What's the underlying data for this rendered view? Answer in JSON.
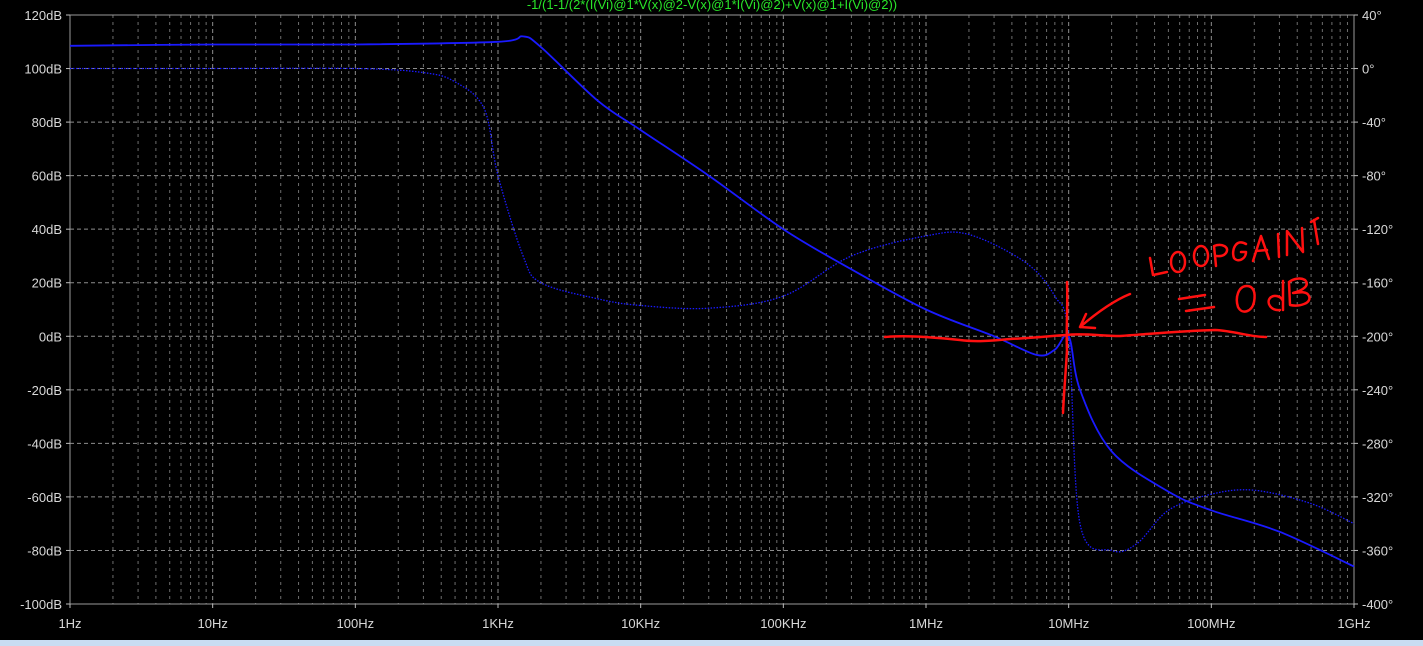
{
  "window": {
    "trace_expression": "-1/(1-1/(2*(I(Vi)@1*V(x)@2-V(x)@1*I(Vi)@2)+V(x)@1+I(Vi)@2))"
  },
  "chart_data": {
    "type": "line",
    "xscale": "log",
    "xlim": [
      1,
      1000000000
    ],
    "x_ticks": [
      1,
      10,
      100,
      1000,
      10000,
      100000,
      1000000,
      10000000,
      100000000,
      1000000000
    ],
    "x_tick_labels": [
      "1Hz",
      "10Hz",
      "100Hz",
      "1KHz",
      "10KHz",
      "100KHz",
      "1MHz",
      "10MHz",
      "100MHz",
      "1GHz"
    ],
    "ylim_left": [
      -100,
      120
    ],
    "y_ticks_left": [
      120,
      100,
      80,
      60,
      40,
      20,
      0,
      -20,
      -40,
      -60,
      -80,
      -100
    ],
    "y_tick_labels_left": [
      "120dB",
      "100dB",
      "80dB",
      "60dB",
      "40dB",
      "20dB",
      "0dB",
      "-20dB",
      "-40dB",
      "-60dB",
      "-80dB",
      "-100dB"
    ],
    "ylim_right": [
      -400,
      40
    ],
    "y_ticks_right": [
      40,
      0,
      -40,
      -80,
      -120,
      -160,
      -200,
      -240,
      -280,
      -320,
      -360,
      -400
    ],
    "y_tick_labels_right": [
      "40°",
      "0°",
      "-40°",
      "-80°",
      "-120°",
      "-160°",
      "-200°",
      "-240°",
      "-280°",
      "-320°",
      "-360°",
      "-400°"
    ],
    "grid": true,
    "series": [
      {
        "role": "magnitude",
        "axis": "left",
        "unit": "dB",
        "style": "solid",
        "color": "#1a1aff",
        "x": [
          1,
          10,
          100,
          1000,
          1500,
          2000,
          5000,
          10000,
          30000,
          100000,
          300000,
          1000000,
          3000000,
          6000000,
          8000000,
          10000000,
          12000000,
          20000000,
          50000000,
          100000000,
          300000000,
          1000000000
        ],
        "y": [
          108.5,
          109,
          109,
          110,
          112,
          108,
          88,
          77,
          60,
          40,
          25,
          10,
          0,
          -7,
          -5,
          0,
          -20,
          -43,
          -58,
          -65,
          -73,
          -86
        ]
      },
      {
        "role": "phase",
        "axis": "right",
        "unit": "deg",
        "style": "dotted",
        "color": "#1a1aff",
        "x": [
          1,
          10,
          100,
          300,
          500,
          800,
          1000,
          1500,
          2000,
          5000,
          10000,
          30000,
          100000,
          300000,
          1000000,
          2000000,
          5000000,
          8000000,
          10000000,
          12000000,
          20000000,
          30000000,
          50000000,
          100000000,
          200000000,
          500000000,
          1000000000
        ],
        "y": [
          0,
          0,
          0,
          -3,
          -10,
          -30,
          -80,
          -140,
          -160,
          -172,
          -177,
          -179,
          -170,
          -140,
          -125,
          -124,
          -145,
          -170,
          -200,
          -340,
          -360,
          -355,
          -330,
          -318,
          -315,
          -325,
          -340
        ]
      }
    ],
    "annotation": {
      "text_line1": "LOOPGAIN",
      "text_line2": "= 0dB",
      "color": "#ff0000",
      "handwritten": true,
      "marks": [
        {
          "kind": "line_along_0dB",
          "x_from": 500000,
          "x_to": 250000000,
          "y": 0
        },
        {
          "kind": "vertical_tick",
          "x": 10000000
        },
        {
          "kind": "arrow_to",
          "x": 10000000,
          "y": 0
        }
      ]
    }
  }
}
